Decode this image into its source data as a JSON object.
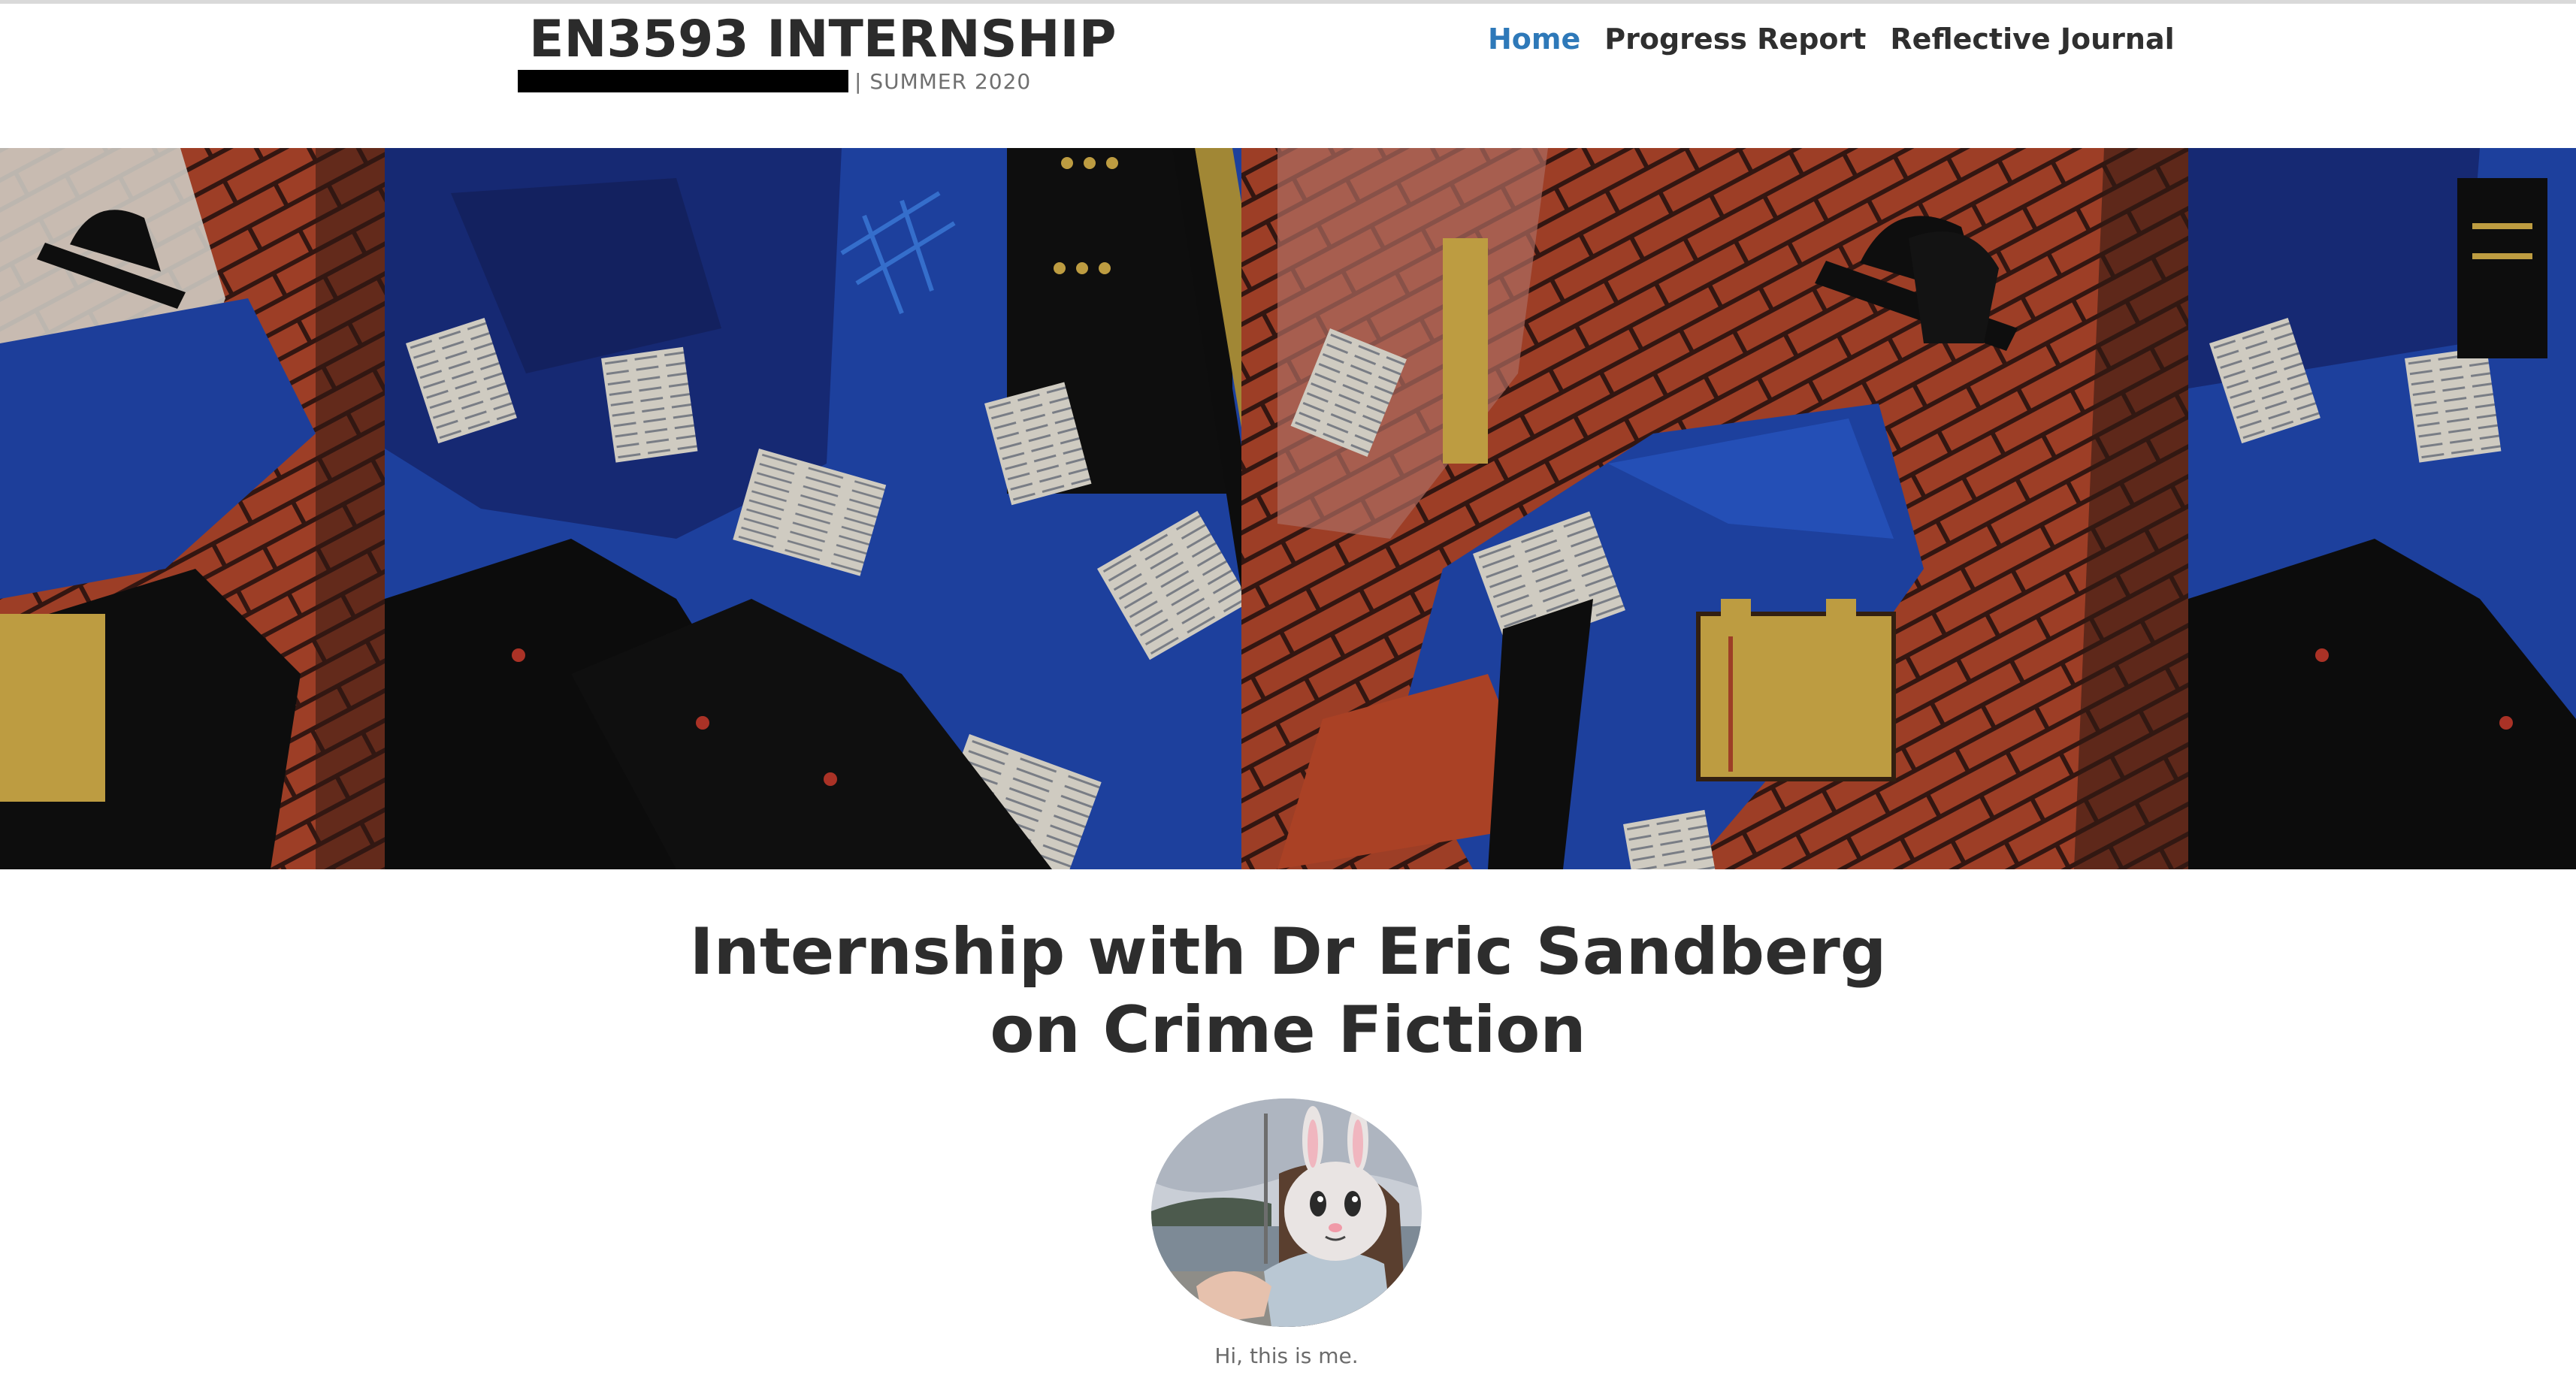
{
  "header": {
    "site_title": "EN3593 INTERNSHIP",
    "tagline": "| SUMMER 2020",
    "redaction_color": "#000000"
  },
  "nav": {
    "items": [
      {
        "label": "Home",
        "active": true
      },
      {
        "label": "Progress Report",
        "active": false
      },
      {
        "label": "Reflective Journal",
        "active": false
      }
    ],
    "active_color": "#2e79b9"
  },
  "hero": {
    "image": "crime-fiction-collage-illustration",
    "palette": [
      "#1d3fa0",
      "#b3472c",
      "#d8b24a",
      "#111111",
      "#e9e4dc"
    ]
  },
  "main": {
    "title": "Internship with Dr Eric Sandberg on Crime Fiction",
    "avatar": {
      "image": "profile-photo-with-bunny-emoji",
      "caption": "Hi, this is me."
    }
  }
}
